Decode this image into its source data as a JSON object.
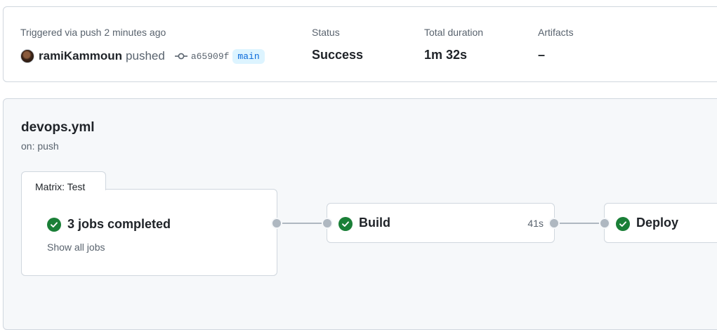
{
  "summary": {
    "trigger_text": "Triggered via push 2 minutes ago",
    "actor": "ramiKammoun",
    "action": "pushed",
    "commit_sha": "a65909f",
    "branch": "main",
    "status_label": "Status",
    "status_value": "Success",
    "duration_label": "Total duration",
    "duration_value": "1m 32s",
    "artifacts_label": "Artifacts",
    "artifacts_value": "–"
  },
  "workflow": {
    "file": "devops.yml",
    "trigger": "on: push",
    "matrix": {
      "tab_label": "Matrix: Test",
      "status_text": "3 jobs completed",
      "show_all": "Show all jobs"
    },
    "jobs": [
      {
        "name": "Build",
        "duration": "41s"
      },
      {
        "name": "Deploy",
        "duration": ""
      }
    ]
  },
  "colors": {
    "success": "#1a7f37",
    "edge": "#afb8c1",
    "branch_bg": "#ddf4ff",
    "branch_text": "#0969da"
  },
  "icons": {
    "success": "check-circle-fill-icon",
    "commit": "git-commit-icon"
  }
}
